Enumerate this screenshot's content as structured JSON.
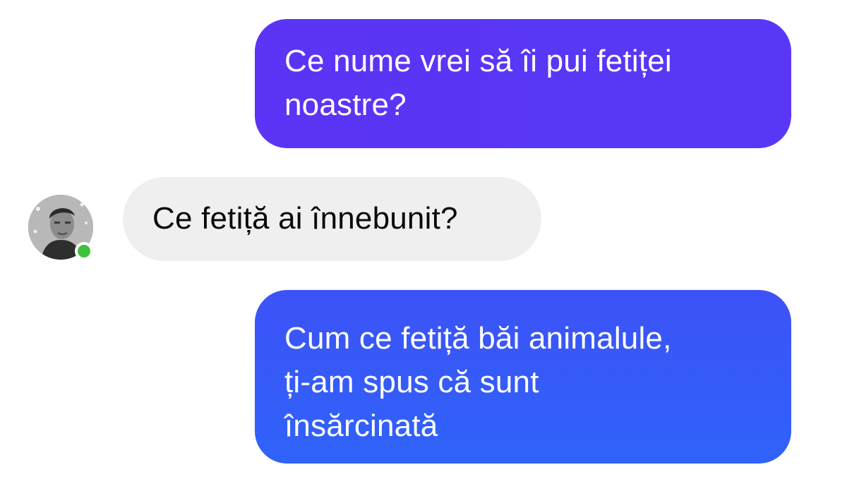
{
  "conversation": {
    "messages": [
      {
        "direction": "outgoing",
        "lines": [
          "Ce nume vrei să îi pui fetiței",
          "noastre?"
        ]
      },
      {
        "direction": "incoming",
        "lines": [
          "Ce fetiță ai înnebunit?"
        ]
      },
      {
        "direction": "outgoing",
        "lines": [
          "Cum ce fetiță băi animalule,",
          "ți-am spus că sunt",
          "însărcinată"
        ]
      }
    ],
    "contact": {
      "avatar_icon": "person-photo-avatar",
      "online_status": "online",
      "status_color": "#3fc13d"
    }
  },
  "colors": {
    "outgoing_top": "#5b34f6",
    "outgoing_bottom": "#2f63f9",
    "incoming_bubble": "#efefef"
  }
}
